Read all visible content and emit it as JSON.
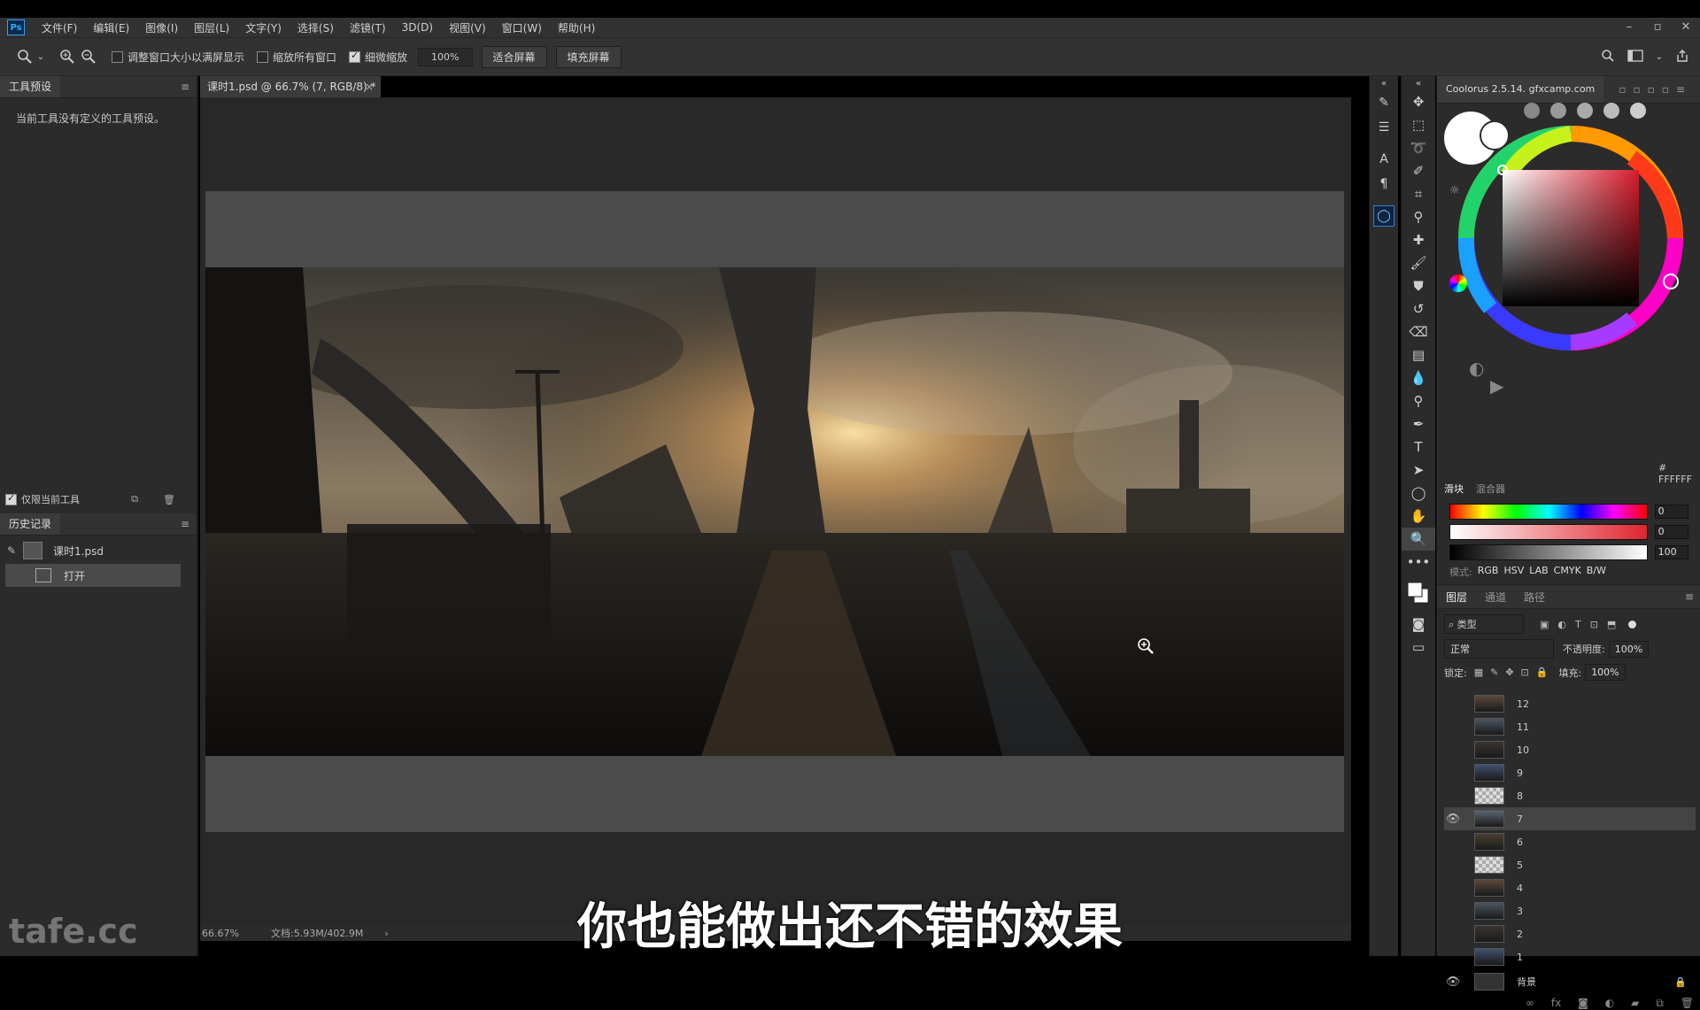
{
  "menubar": {
    "logo": "Ps",
    "items": [
      "文件(F)",
      "编辑(E)",
      "图像(I)",
      "图层(L)",
      "文字(Y)",
      "选择(S)",
      "滤镜(T)",
      "3D(D)",
      "视图(V)",
      "窗口(W)",
      "帮助(H)"
    ],
    "window_controls": [
      "–",
      "▫",
      "✕"
    ]
  },
  "options_bar": {
    "resize_windows_label": "调整窗口大小以满屏显示",
    "zoom_all_label": "缩放所有窗口",
    "scrubby_zoom_label": "细微缩放",
    "scrubby_zoom_checked": true,
    "zoom_value": "100%",
    "fit_screen": "适合屏幕",
    "fill_screen": "填充屏幕"
  },
  "tool_presets": {
    "tab": "工具预设",
    "empty_message": "当前工具没有定义的工具预设。",
    "current_tool_only": "仅限当前工具"
  },
  "history": {
    "tab": "历史记录",
    "snapshot": "课时1.psd",
    "items": [
      "打开"
    ]
  },
  "document": {
    "tab_title": "课时1.psd @ 66.7% (7, RGB/8) *",
    "zoom": "66.67%",
    "doc_info": "文档:5.93M/402.9M"
  },
  "subtitle": "你也能做出还不错的效果",
  "watermark": "tafe.cc",
  "colorus": {
    "title": "Coolorus 2.5.14. gfxcamp.com",
    "hex": "# FFFFFF",
    "tabs": [
      "滑块",
      "混合器"
    ],
    "slider_values": [
      "0",
      "0",
      "100"
    ],
    "modes_label": "模式:",
    "modes": [
      "RGB",
      "HSV",
      "LAB",
      "CMYK",
      "B/W"
    ],
    "hue_color": "#d81b2b"
  },
  "layers": {
    "tabs": [
      "图层",
      "通道",
      "路径"
    ],
    "filter_kind": "类型",
    "blend_mode": "正常",
    "opacity_label": "不透明度:",
    "opacity_value": "100%",
    "lock_label": "锁定:",
    "fill_label": "填充:",
    "fill_value": "100%",
    "rows": [
      {
        "name": "12",
        "visible": false,
        "thumb": "photo"
      },
      {
        "name": "11",
        "visible": false,
        "thumb": "photo"
      },
      {
        "name": "10",
        "visible": false,
        "thumb": "photo"
      },
      {
        "name": "9",
        "visible": false,
        "thumb": "photo"
      },
      {
        "name": "8",
        "visible": false,
        "thumb": "checker"
      },
      {
        "name": "7",
        "visible": true,
        "thumb": "photo",
        "selected": true
      },
      {
        "name": "6",
        "visible": false,
        "thumb": "photo"
      },
      {
        "name": "5",
        "visible": false,
        "thumb": "checker"
      },
      {
        "name": "4",
        "visible": false,
        "thumb": "photo"
      },
      {
        "name": "3",
        "visible": false,
        "thumb": "photo"
      },
      {
        "name": "2",
        "visible": false,
        "thumb": "photo"
      },
      {
        "name": "1",
        "visible": false,
        "thumb": "photo"
      }
    ],
    "background": {
      "name": "背景",
      "visible": true
    }
  }
}
